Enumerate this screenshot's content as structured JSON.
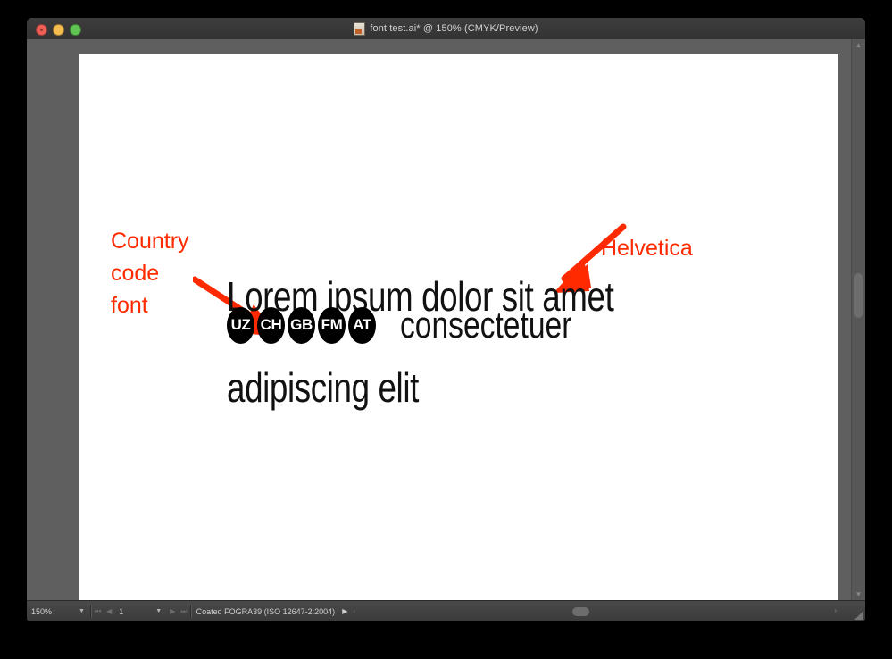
{
  "window": {
    "title": "font test.ai* @ 150% (CMYK/Preview)",
    "traffic_lights": [
      "close",
      "minimize",
      "maximize"
    ],
    "doc_icon": "illustrator-document-icon"
  },
  "annotations": {
    "left": {
      "text": "Country\ncode\nfont",
      "color": "#ff2a00",
      "arrow": "hand-drawn-arrow-down-right"
    },
    "right": {
      "text": "Helvetica",
      "color": "#ff2a00",
      "arrow": "hand-drawn-arrow-down-left"
    }
  },
  "artwork": {
    "line1": "Lorem ipsum dolor sit amet",
    "country_codes": [
      "UZ",
      "CH",
      "GB",
      "FM",
      "AT"
    ],
    "line2_word": "consectetuer",
    "line3": "adipiscing elit",
    "text_color": "#111111",
    "badge_color": "#000000"
  },
  "statusbar": {
    "zoom_level": "150%",
    "page_number": "1",
    "color_profile": "Coated FOGRA39 (ISO 12647-2:2004)",
    "zoom_chevron": "chevron-down-icon",
    "page_chevron": "chevron-down-icon",
    "first_page": "⏮",
    "prev_page": "◀",
    "next_page": "▶",
    "last_page": "⏭",
    "profile_menu": "▶",
    "profile_extra": "‹"
  },
  "scrollbars": {
    "vertical_up": "▲",
    "vertical_down": "▼",
    "horizontal_right": "›"
  }
}
